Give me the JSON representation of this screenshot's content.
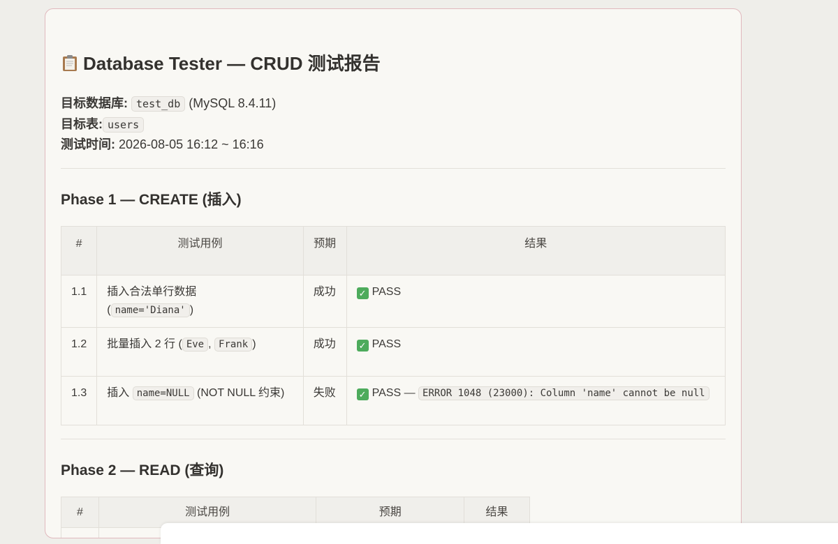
{
  "report": {
    "title": "Database Tester — CRUD 测试报告",
    "meta": {
      "db_label": "目标数据库:",
      "db_name": "test_db",
      "db_version": "(MySQL 8.4.11)",
      "table_label": "目标表:",
      "table_name": "users",
      "time_label": "测试时间:",
      "time_value": "2026-08-05 16:12 ~ 16:16"
    }
  },
  "phase1": {
    "heading": "Phase 1 — CREATE (插入)",
    "headers": [
      "#",
      "测试用例",
      "预期",
      "结果"
    ],
    "rows": [
      {
        "num": "1.1",
        "case_text": "插入合法单行数据",
        "case_open": "(",
        "case_code": "name='Diana'",
        "case_close": ")",
        "expected": "成功",
        "result": "PASS"
      },
      {
        "num": "1.2",
        "case_text": "批量插入 2 行 (",
        "case_code1": "Eve",
        "case_sep": ",",
        "case_code2": "Frank",
        "case_close": ")",
        "expected": "成功",
        "result": "PASS"
      },
      {
        "num": "1.3",
        "case_text": "插入",
        "case_code": "name=NULL",
        "case_suffix": "(NOT NULL 约束)",
        "expected": "失败",
        "result": "PASS —",
        "result_code": "ERROR 1048 (23000): Column 'name' cannot be null"
      }
    ]
  },
  "phase2": {
    "heading": "Phase 2 — READ (查询)",
    "headers": [
      "#",
      "测试用例",
      "预期",
      "结果"
    ]
  },
  "colors": {
    "card_border": "#e0b8bd",
    "pass_green": "#4dab5c"
  }
}
